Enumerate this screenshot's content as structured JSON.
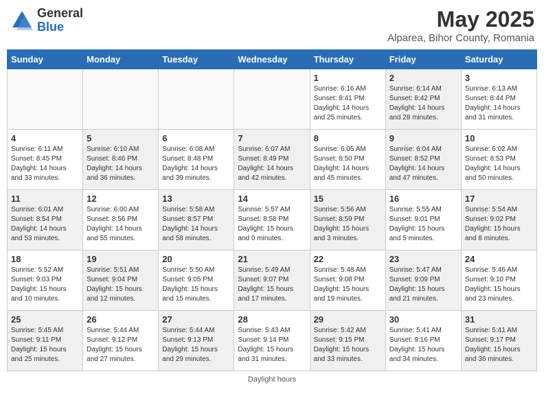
{
  "header": {
    "logo_general": "General",
    "logo_blue": "Blue",
    "title": "May 2025",
    "subtitle": "Alparea, Bihor County, Romania"
  },
  "footer": {
    "label": "Daylight hours"
  },
  "days_of_week": [
    "Sunday",
    "Monday",
    "Tuesday",
    "Wednesday",
    "Thursday",
    "Friday",
    "Saturday"
  ],
  "weeks": [
    [
      {
        "num": "",
        "info": "",
        "empty": true
      },
      {
        "num": "",
        "info": "",
        "empty": true
      },
      {
        "num": "",
        "info": "",
        "empty": true
      },
      {
        "num": "",
        "info": "",
        "empty": true
      },
      {
        "num": "1",
        "info": "Sunrise: 6:16 AM\nSunset: 8:41 PM\nDaylight: 14 hours\nand 25 minutes.",
        "shaded": false
      },
      {
        "num": "2",
        "info": "Sunrise: 6:14 AM\nSunset: 8:42 PM\nDaylight: 14 hours\nand 28 minutes.",
        "shaded": true
      },
      {
        "num": "3",
        "info": "Sunrise: 6:13 AM\nSunset: 8:44 PM\nDaylight: 14 hours\nand 31 minutes.",
        "shaded": false
      }
    ],
    [
      {
        "num": "4",
        "info": "Sunrise: 6:11 AM\nSunset: 8:45 PM\nDaylight: 14 hours\nand 33 minutes.",
        "shaded": false
      },
      {
        "num": "5",
        "info": "Sunrise: 6:10 AM\nSunset: 8:46 PM\nDaylight: 14 hours\nand 36 minutes.",
        "shaded": true
      },
      {
        "num": "6",
        "info": "Sunrise: 6:08 AM\nSunset: 8:48 PM\nDaylight: 14 hours\nand 39 minutes.",
        "shaded": false
      },
      {
        "num": "7",
        "info": "Sunrise: 6:07 AM\nSunset: 8:49 PM\nDaylight: 14 hours\nand 42 minutes.",
        "shaded": true
      },
      {
        "num": "8",
        "info": "Sunrise: 6:05 AM\nSunset: 8:50 PM\nDaylight: 14 hours\nand 45 minutes.",
        "shaded": false
      },
      {
        "num": "9",
        "info": "Sunrise: 6:04 AM\nSunset: 8:52 PM\nDaylight: 14 hours\nand 47 minutes.",
        "shaded": true
      },
      {
        "num": "10",
        "info": "Sunrise: 6:02 AM\nSunset: 8:53 PM\nDaylight: 14 hours\nand 50 minutes.",
        "shaded": false
      }
    ],
    [
      {
        "num": "11",
        "info": "Sunrise: 6:01 AM\nSunset: 8:54 PM\nDaylight: 14 hours\nand 53 minutes.",
        "shaded": true
      },
      {
        "num": "12",
        "info": "Sunrise: 6:00 AM\nSunset: 8:56 PM\nDaylight: 14 hours\nand 55 minutes.",
        "shaded": false
      },
      {
        "num": "13",
        "info": "Sunrise: 5:58 AM\nSunset: 8:57 PM\nDaylight: 14 hours\nand 58 minutes.",
        "shaded": true
      },
      {
        "num": "14",
        "info": "Sunrise: 5:57 AM\nSunset: 8:58 PM\nDaylight: 15 hours\nand 0 minutes.",
        "shaded": false
      },
      {
        "num": "15",
        "info": "Sunrise: 5:56 AM\nSunset: 8:59 PM\nDaylight: 15 hours\nand 3 minutes.",
        "shaded": true
      },
      {
        "num": "16",
        "info": "Sunrise: 5:55 AM\nSunset: 9:01 PM\nDaylight: 15 hours\nand 5 minutes.",
        "shaded": false
      },
      {
        "num": "17",
        "info": "Sunrise: 5:54 AM\nSunset: 9:02 PM\nDaylight: 15 hours\nand 8 minutes.",
        "shaded": true
      }
    ],
    [
      {
        "num": "18",
        "info": "Sunrise: 5:52 AM\nSunset: 9:03 PM\nDaylight: 15 hours\nand 10 minutes.",
        "shaded": false
      },
      {
        "num": "19",
        "info": "Sunrise: 5:51 AM\nSunset: 9:04 PM\nDaylight: 15 hours\nand 12 minutes.",
        "shaded": true
      },
      {
        "num": "20",
        "info": "Sunrise: 5:50 AM\nSunset: 9:05 PM\nDaylight: 15 hours\nand 15 minutes.",
        "shaded": false
      },
      {
        "num": "21",
        "info": "Sunrise: 5:49 AM\nSunset: 9:07 PM\nDaylight: 15 hours\nand 17 minutes.",
        "shaded": true
      },
      {
        "num": "22",
        "info": "Sunrise: 5:48 AM\nSunset: 9:08 PM\nDaylight: 15 hours\nand 19 minutes.",
        "shaded": false
      },
      {
        "num": "23",
        "info": "Sunrise: 5:47 AM\nSunset: 9:09 PM\nDaylight: 15 hours\nand 21 minutes.",
        "shaded": true
      },
      {
        "num": "24",
        "info": "Sunrise: 5:46 AM\nSunset: 9:10 PM\nDaylight: 15 hours\nand 23 minutes.",
        "shaded": false
      }
    ],
    [
      {
        "num": "25",
        "info": "Sunrise: 5:45 AM\nSunset: 9:11 PM\nDaylight: 15 hours\nand 25 minutes.",
        "shaded": true
      },
      {
        "num": "26",
        "info": "Sunrise: 5:44 AM\nSunset: 9:12 PM\nDaylight: 15 hours\nand 27 minutes.",
        "shaded": false
      },
      {
        "num": "27",
        "info": "Sunrise: 5:44 AM\nSunset: 9:13 PM\nDaylight: 15 hours\nand 29 minutes.",
        "shaded": true
      },
      {
        "num": "28",
        "info": "Sunrise: 5:43 AM\nSunset: 9:14 PM\nDaylight: 15 hours\nand 31 minutes.",
        "shaded": false
      },
      {
        "num": "29",
        "info": "Sunrise: 5:42 AM\nSunset: 9:15 PM\nDaylight: 15 hours\nand 33 minutes.",
        "shaded": true
      },
      {
        "num": "30",
        "info": "Sunrise: 5:41 AM\nSunset: 9:16 PM\nDaylight: 15 hours\nand 34 minutes.",
        "shaded": false
      },
      {
        "num": "31",
        "info": "Sunrise: 5:41 AM\nSunset: 9:17 PM\nDaylight: 15 hours\nand 36 minutes.",
        "shaded": true
      }
    ]
  ]
}
